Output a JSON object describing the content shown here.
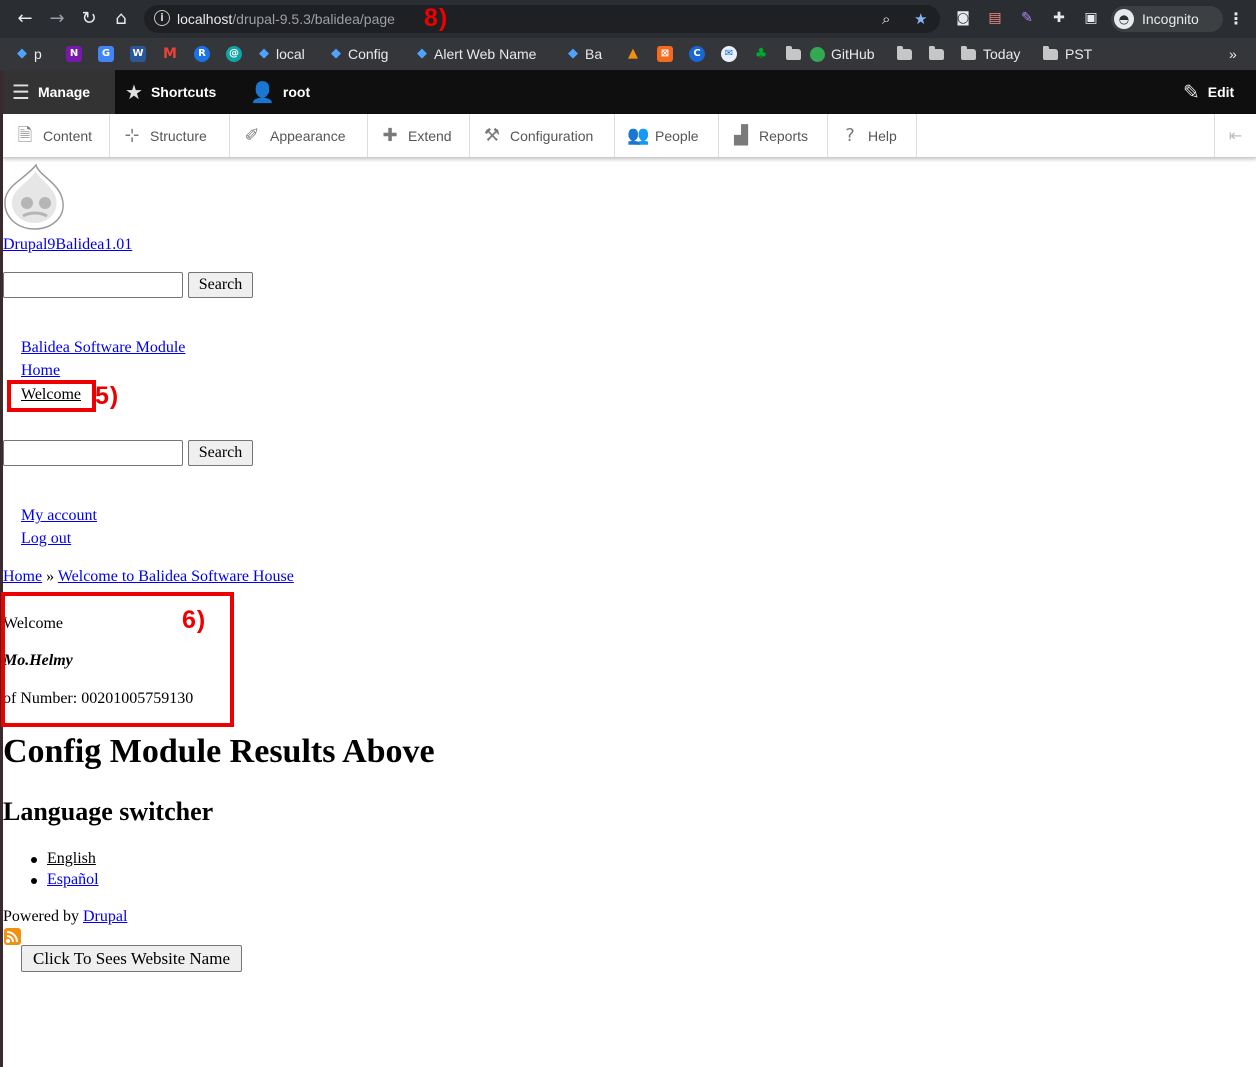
{
  "browser": {
    "url_host": "localhost",
    "url_path": "/drupal-9.5.3/balidea/page",
    "incognito_label": "Incognito",
    "bookmarks": [
      {
        "label": "p"
      },
      {
        "label": "local"
      },
      {
        "label": "Config"
      },
      {
        "label": "Alert Web Name"
      },
      {
        "label": "Ba"
      },
      {
        "label": "GitHub"
      },
      {
        "label": "Today"
      },
      {
        "label": "PST"
      }
    ],
    "overflow": "»"
  },
  "toolbar": {
    "manage": "Manage",
    "shortcuts": "Shortcuts",
    "user": "root",
    "edit": "Edit"
  },
  "tray": {
    "items": [
      {
        "label": "Content"
      },
      {
        "label": "Structure"
      },
      {
        "label": "Appearance"
      },
      {
        "label": "Extend"
      },
      {
        "label": "Configuration"
      },
      {
        "label": "People"
      },
      {
        "label": "Reports"
      },
      {
        "label": "Help"
      }
    ]
  },
  "page": {
    "site_name": "Drupal9Balidea1.01",
    "search_button": "Search",
    "main_menu": [
      {
        "label": "Balidea Software Module"
      },
      {
        "label": "Home"
      },
      {
        "label": "Welcome"
      }
    ],
    "account_menu": [
      {
        "label": "My account"
      },
      {
        "label": "Log out"
      }
    ],
    "breadcrumb": {
      "home": "Home",
      "separator": "»",
      "current": "Welcome to Balidea Software House"
    },
    "block": {
      "welcome": "Welcome",
      "name": "Mo.Helmy",
      "number": "of Number: 00201005759130"
    },
    "config_heading": "Config Module Results Above",
    "language_heading": "Language switcher",
    "languages": [
      {
        "label": "English"
      },
      {
        "label": "Español"
      }
    ],
    "powered_by": "Powered by ",
    "powered_link": "Drupal",
    "site_name_button": "Click To Sees Website Name"
  },
  "annotations": {
    "label_8": "8)",
    "label_5": "5)",
    "label_6": "6)",
    "color": "#ee0000"
  }
}
